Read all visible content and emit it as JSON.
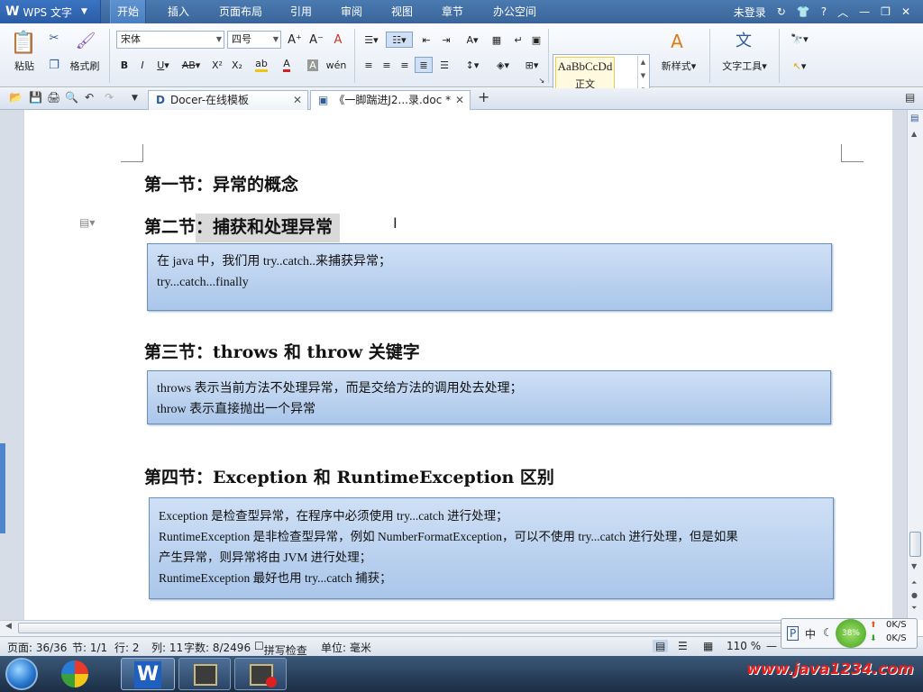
{
  "app": {
    "name": "WPS 文字"
  },
  "menu": {
    "tabs": [
      "开始",
      "插入",
      "页面布局",
      "引用",
      "审阅",
      "视图",
      "章节",
      "办公空间"
    ],
    "login": "未登录"
  },
  "ribbon": {
    "paste": "粘贴",
    "format_painter": "格式刷",
    "font_name": "宋体",
    "font_size": "四号",
    "style_sample": "AaBbCcDd",
    "style_name": "正文",
    "new_style": "新样式",
    "text_tools": "文字工具"
  },
  "tabs": [
    {
      "label": "Docer-在线模板"
    },
    {
      "label": "《一脚踹进J2...录.doc *"
    }
  ],
  "document": {
    "h1": "第一节：异常的概念",
    "h2_prefix": "第二节",
    "h2_selected": "：捕获和处理异常",
    "box1": [
      "在 java 中，我们用 try..catch..来捕获异常；",
      "try...catch...finally"
    ],
    "h3": "第三节：throws 和 throw 关键字",
    "box2": [
      "throws 表示当前方法不处理异常，而是交给方法的调用处去处理；",
      "throw  表示直接抛出一个异常"
    ],
    "h4": "第四节：Exception 和 RuntimeException 区别",
    "box3": [
      "Exception 是检查型异常，在程序中必须使用 try...catch 进行处理；",
      "RuntimeException 是非检查型异常，例如 NumberFormatException，可以不使用 try...catch 进行处理，但是如果",
      "产生异常，则异常将由 JVM 进行处理；",
      "RuntimeException 最好也用 try...catch 捕获；"
    ]
  },
  "status": {
    "page": "页面: 36/36",
    "section": "节: 1/1",
    "row": "行: 2",
    "col": "列: 11",
    "words": "字数: 8/2496",
    "spell": "拼写检查",
    "unit": "单位: 毫米",
    "zoom": "110 %"
  },
  "net": {
    "percent": "38%",
    "up": "0K/S",
    "down": "0K/S",
    "ime": "中"
  },
  "watermark": "www.java1234.com"
}
